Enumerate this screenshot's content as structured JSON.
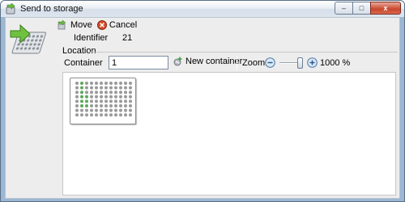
{
  "window": {
    "title": "Send to storage",
    "controls": {
      "minimize": "–",
      "maximize": "□",
      "close": "x"
    }
  },
  "toolbar": {
    "move_label": "Move",
    "cancel_label": "Cancel",
    "move_icon": "move-arrow-icon",
    "cancel_icon": "cancel-x-icon"
  },
  "identifier": {
    "label": "Identifier",
    "value": "21"
  },
  "location": {
    "group_label": "Location",
    "container_label": "Container",
    "container_value": "1",
    "new_container_label": "New container",
    "zoom_label": "Zoom:",
    "zoom_value": "1000 %",
    "zoom_level_fraction": 1.0
  },
  "plate": {
    "rows": 8,
    "cols": 12,
    "occupied_color": "#5da95a",
    "empty_color": "#9a9a9a",
    "occupied": [
      [
        0,
        1
      ],
      [
        1,
        1
      ],
      [
        2,
        1
      ],
      [
        3,
        1
      ],
      [
        4,
        1
      ],
      [
        5,
        1
      ],
      [
        3,
        2
      ],
      [
        4,
        2
      ],
      [
        5,
        2
      ]
    ]
  },
  "colors": {
    "accent": "#9bb7d3",
    "close": "#c9462c"
  }
}
